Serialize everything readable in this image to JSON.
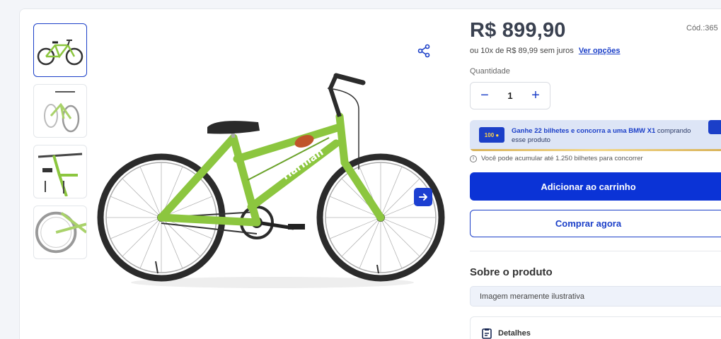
{
  "product": {
    "price": "R$ 899,90",
    "code": "Cód.:365",
    "installments_text": "ou 10x de R$ 89,99 sem juros",
    "installments_link": "Ver opções",
    "quantity_label": "Quantidade",
    "quantity": "1",
    "qty_minus": "−",
    "qty_plus": "+"
  },
  "promo": {
    "bold_text": "Ganhe 22 bilhetes e concorra a uma BMW X1",
    "rest_text": " comprando esse produto",
    "ticket_label": "100 ●"
  },
  "info_text": "Você pode acumular até 1.250 bilhetes para concorrer",
  "buttons": {
    "add_to_cart": "Adicionar ao carrinho",
    "buy_now": "Comprar agora"
  },
  "about": {
    "title": "Sobre o produto",
    "illustrative": "Imagem meramente ilustrativa",
    "details": "Detalhes"
  },
  "colors": {
    "brand_blue": "#0b33d6",
    "bike_green": "#8cc63f"
  },
  "icons": {
    "share": "share-icon",
    "next": "arrow-right-icon",
    "info": "info-icon",
    "details": "clipboard-icon"
  }
}
